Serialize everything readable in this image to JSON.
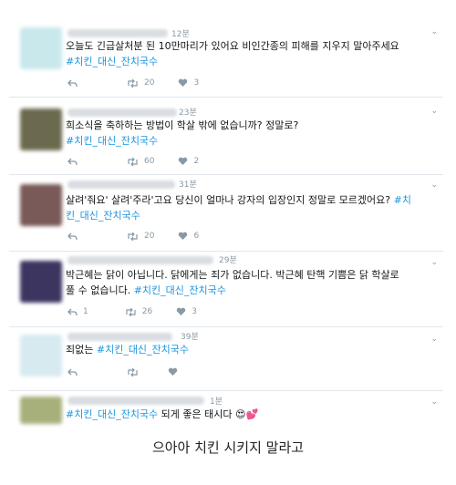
{
  "tweets": [
    {
      "time": "12분",
      "text_plain": "오늘도 긴급살처분 된 10만마리가 있어요 비인간종의 피해를 지우지 말아주세요",
      "hashtag_inline": "",
      "hashtag_line": "#치킨_대신_잔치국수",
      "retweets": "20",
      "likes": "3",
      "avatar_color": "#c9e8ec"
    },
    {
      "time": "23분",
      "text_plain": "희소식을 축하하는 방법이 학살 밖에 없습니까? 정말로?",
      "hashtag_inline": "",
      "hashtag_line": "#치킨_대신_잔치국수",
      "retweets": "60",
      "likes": "2",
      "avatar_color": "#6b6a4e"
    },
    {
      "time": "31분",
      "text_plain": "살려'줘요' 살려'주라'고요 당신이 얼마나 강자의 입장인지 정말로 모르겠어요? ",
      "hashtag_inline": "#치",
      "hashtag_line": "킨_대신_잔치국수",
      "retweets": "20",
      "likes": "6",
      "avatar_color": "#7a5a58"
    },
    {
      "time": "29분",
      "text_plain": "박근혜는 닭이 아닙니다. 닭에게는 죄가 없습니다. 박근혜 탄핵 기쁨은 닭 학살로",
      "line2_plain": "풀 수 없습니다. ",
      "hashtag_line": "#치킨_대신_잔치국수",
      "replies": "1",
      "retweets": "26",
      "likes": "3",
      "avatar_color": "#3b3560"
    },
    {
      "time": "39분",
      "text_plain": "죄없는 ",
      "hashtag_line": "#치킨_대신_잔치국수",
      "retweets": "",
      "likes": "",
      "avatar_color": "#d7eaf0"
    },
    {
      "time": "1분",
      "hashtag_line": "#치킨_대신_잔치국수",
      "text_plain": " 되게 좋은 태시다 ",
      "emoji": "😍💕",
      "avatar_color": "#a7b07a"
    }
  ],
  "caption": "으아아 치킨 시키지 말라고",
  "icons": {
    "reply": "reply-icon",
    "retweet": "retweet-icon",
    "like": "heart-icon",
    "more": "chevron-down-icon"
  }
}
